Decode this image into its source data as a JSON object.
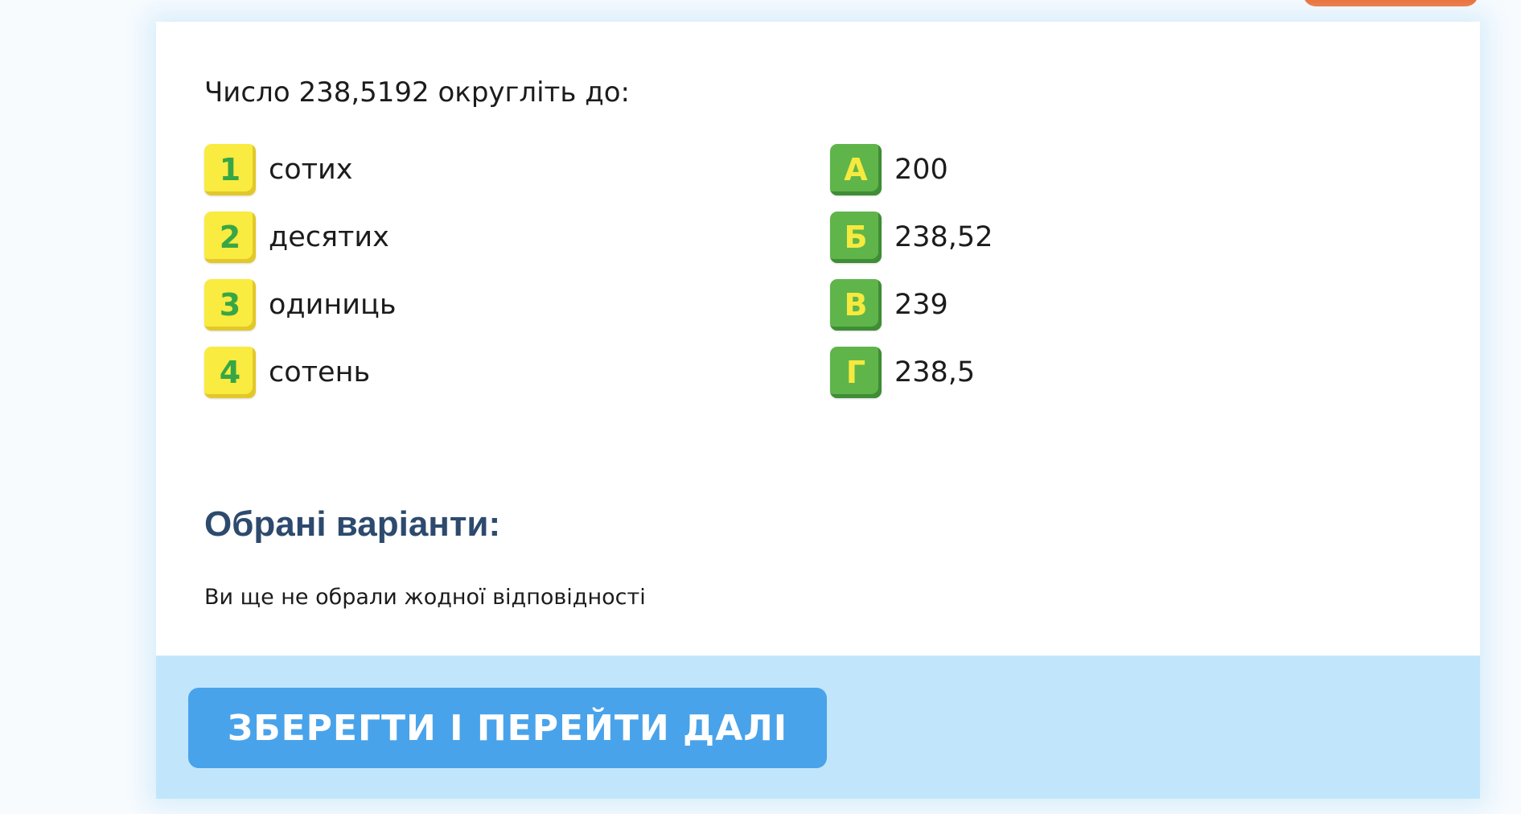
{
  "question": "Число 238,5192 округліть до:",
  "left_options": [
    {
      "badge": "1",
      "label": "сотих"
    },
    {
      "badge": "2",
      "label": "десятих"
    },
    {
      "badge": "3",
      "label": "одиниць"
    },
    {
      "badge": "4",
      "label": "сотень"
    }
  ],
  "right_options": [
    {
      "badge": "А",
      "label": "200"
    },
    {
      "badge": "Б",
      "label": "238,52"
    },
    {
      "badge": "В",
      "label": "239"
    },
    {
      "badge": "Г",
      "label": "238,5"
    }
  ],
  "selected": {
    "title": "Обрані варіанти:",
    "empty_text": "Ви ще не обрали жодної відповідності"
  },
  "footer": {
    "save_label": "ЗБЕРЕГТИ І ПЕРЕЙТИ ДАЛІ"
  },
  "colors": {
    "accent_button": "#49a3ea",
    "footer_band": "#c1e6fb",
    "badge_yellow": "#f9eb3f",
    "badge_green": "#5fb54a",
    "heading": "#2d4a6e",
    "top_pill": "#ee6a2c"
  }
}
